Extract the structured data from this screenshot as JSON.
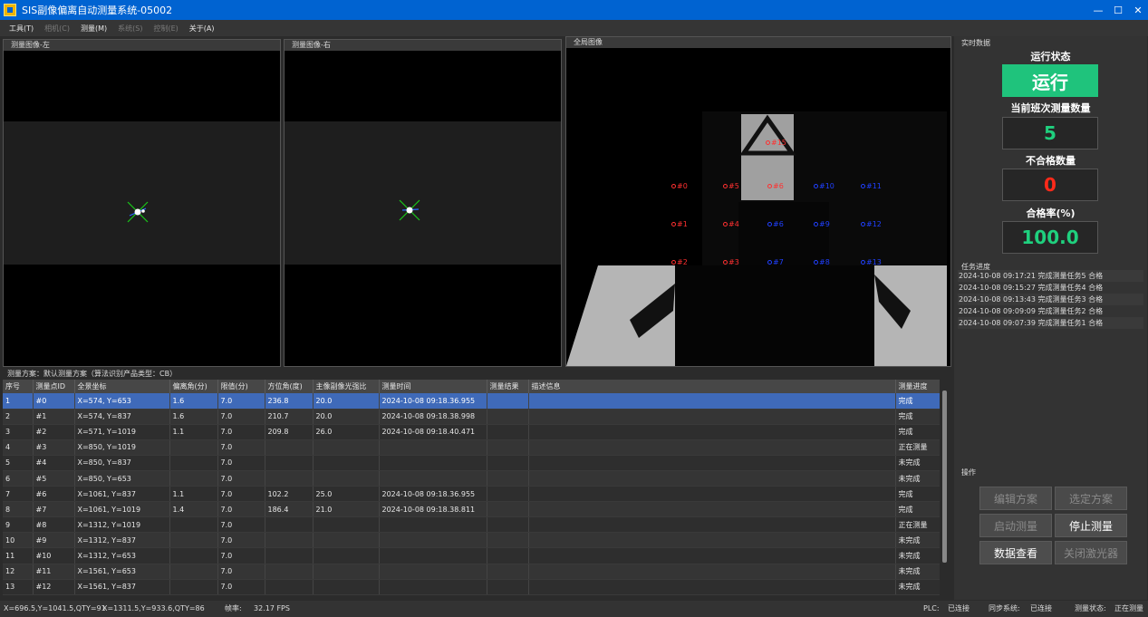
{
  "window": {
    "title": "SIS副像偏离自动测量系统-05002",
    "minimize": "—",
    "maximize": "☐",
    "close": "✕"
  },
  "menu": [
    {
      "label": "工具(T)",
      "enabled": true
    },
    {
      "label": "相机(C)",
      "enabled": false
    },
    {
      "label": "测量(M)",
      "enabled": true
    },
    {
      "label": "系统(S)",
      "enabled": false
    },
    {
      "label": "控制(E)",
      "enabled": false
    },
    {
      "label": "关于(A)",
      "enabled": true
    }
  ],
  "panels": {
    "left": "测量图像-左",
    "right": "测量图像-右",
    "full": "全局图像"
  },
  "full_image_points": [
    {
      "label": "#0",
      "color": "#ff3030"
    },
    {
      "label": "#5",
      "color": "#ff3030"
    },
    {
      "label": "#6",
      "color": "#ff3030"
    },
    {
      "label": "#10",
      "color": "#2040ff"
    },
    {
      "label": "#11",
      "color": "#2040ff"
    },
    {
      "label": "#1",
      "color": "#ff3030"
    },
    {
      "label": "#4",
      "color": "#ff3030"
    },
    {
      "label": "#6",
      "color": "#2040ff"
    },
    {
      "label": "#9",
      "color": "#2040ff"
    },
    {
      "label": "#12",
      "color": "#2040ff"
    },
    {
      "label": "#2",
      "color": "#ff3030"
    },
    {
      "label": "#3",
      "color": "#ff3030"
    },
    {
      "label": "#7",
      "color": "#2040ff"
    },
    {
      "label": "#8",
      "color": "#2040ff"
    },
    {
      "label": "#13",
      "color": "#2040ff"
    },
    {
      "label": "#15",
      "color": "#ff3030"
    }
  ],
  "realtime": {
    "section": "实时数据",
    "run_state_title": "运行状态",
    "run_state": "运行",
    "count_title": "当前班次测量数量",
    "count": "5",
    "fail_title": "不合格数量",
    "fail": "0",
    "rate_title": "合格率(%)",
    "rate": "100.0"
  },
  "colors": {
    "count": "#1fd07e",
    "fail": "#ff2a1a",
    "rate": "#1fd07e",
    "status_bg": "#1fc37c"
  },
  "task_progress": {
    "section": "任务进度",
    "logs": [
      "2024-10-08  09:17:21 完成测量任务5 合格",
      "2024-10-08  09:15:27 完成测量任务4 合格",
      "2024-10-08  09:13:43 完成测量任务3 合格",
      "2024-10-08  09:09:09 完成测量任务2 合格",
      "2024-10-08  09:07:39 完成测量任务1 合格"
    ]
  },
  "operations": {
    "section": "操作",
    "edit_scheme": "编辑方案",
    "select_scheme": "选定方案",
    "start_measure": "启动测量",
    "stop_measure": "停止测量",
    "view_data": "数据查看",
    "close_laser": "关闭激光器"
  },
  "scheme_text": "测量方案：默认测量方案（算法识别产品类型：CB）",
  "table": {
    "columns": [
      "序号",
      "测量点ID",
      "全景坐标",
      "偏离角(分)",
      "限值(分)",
      "方位角(度)",
      "主像副像光强比",
      "测量时间",
      "测量结果",
      "描述信息",
      "测量进度"
    ],
    "rows": [
      [
        "1",
        "#0",
        "X=574, Y=653",
        "1.6",
        "7.0",
        "236.8",
        "20.0",
        "2024-10-08 09:18.36.955",
        "",
        "",
        "完成"
      ],
      [
        "2",
        "#1",
        "X=574, Y=837",
        "1.6",
        "7.0",
        "210.7",
        "20.0",
        "2024-10-08 09:18.38.998",
        "",
        "",
        "完成"
      ],
      [
        "3",
        "#2",
        "X=571, Y=1019",
        "1.1",
        "7.0",
        "209.8",
        "26.0",
        "2024-10-08 09:18.40.471",
        "",
        "",
        "完成"
      ],
      [
        "4",
        "#3",
        "X=850, Y=1019",
        "",
        "7.0",
        "",
        "",
        "",
        "",
        "",
        "正在测量"
      ],
      [
        "5",
        "#4",
        "X=850, Y=837",
        "",
        "7.0",
        "",
        "",
        "",
        "",
        "",
        "未完成"
      ],
      [
        "6",
        "#5",
        "X=850, Y=653",
        "",
        "7.0",
        "",
        "",
        "",
        "",
        "",
        "未完成"
      ],
      [
        "7",
        "#6",
        "X=1061, Y=837",
        "1.1",
        "7.0",
        "102.2",
        "25.0",
        "2024-10-08 09:18.36.955",
        "",
        "",
        "完成"
      ],
      [
        "8",
        "#7",
        "X=1061, Y=1019",
        "1.4",
        "7.0",
        "186.4",
        "21.0",
        "2024-10-08 09:18.38.811",
        "",
        "",
        "完成"
      ],
      [
        "9",
        "#8",
        "X=1312, Y=1019",
        "",
        "7.0",
        "",
        "",
        "",
        "",
        "",
        "正在测量"
      ],
      [
        "10",
        "#9",
        "X=1312, Y=837",
        "",
        "7.0",
        "",
        "",
        "",
        "",
        "",
        "未完成"
      ],
      [
        "11",
        "#10",
        "X=1312, Y=653",
        "",
        "7.0",
        "",
        "",
        "",
        "",
        "",
        "未完成"
      ],
      [
        "12",
        "#11",
        "X=1561, Y=653",
        "",
        "7.0",
        "",
        "",
        "",
        "",
        "",
        "未完成"
      ],
      [
        "13",
        "#12",
        "X=1561, Y=837",
        "",
        "7.0",
        "",
        "",
        "",
        "",
        "",
        "未完成"
      ]
    ]
  },
  "statusbar": {
    "coord_left": "X=696.5,Y=1041.5,QTY=91",
    "coord_right": "X=1311.5,Y=933.6,QTY=86",
    "fps_label": "帧率:",
    "fps": "32.17 FPS",
    "plc_label": "PLC:",
    "plc": "已连接",
    "sync_label": "同步系统:",
    "sync": "已连接",
    "measure_label": "测量状态:",
    "measure": "正在测量"
  }
}
